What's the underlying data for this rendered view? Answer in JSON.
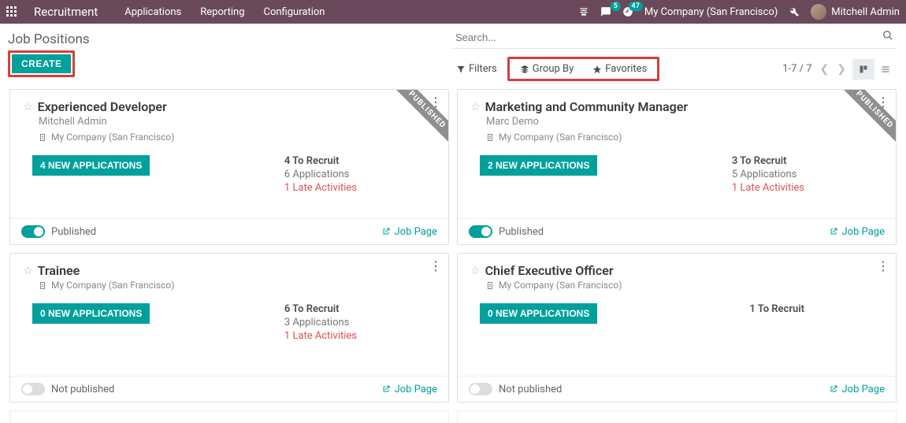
{
  "navbar": {
    "brand": "Recruitment",
    "menu": [
      "Applications",
      "Reporting",
      "Configuration"
    ],
    "messages_badge": "5",
    "activities_badge": "47",
    "company": "My Company (San Francisco)",
    "user": "Mitchell Admin"
  },
  "header": {
    "title": "Job Positions",
    "create_label": "CREATE",
    "search_placeholder": "Search...",
    "filters_label": "Filters",
    "groupby_label": "Group By",
    "favorites_label": "Favorites",
    "pager": "1-7 / 7"
  },
  "common": {
    "job_page_label": "Job Page",
    "published_label": "Published",
    "not_published_label": "Not published",
    "ribbon_label": "PUBLISHED"
  },
  "cards": [
    {
      "title": "Experienced Developer",
      "owner": "Mitchell Admin",
      "company": "My Company (San Francisco)",
      "app_button": "4 NEW APPLICATIONS",
      "recruit": "4 To Recruit",
      "apps": "6 Applications",
      "late": "1 Late Activities",
      "published": true
    },
    {
      "title": "Marketing and Community Manager",
      "owner": "Marc Demo",
      "company": "My Company (San Francisco)",
      "app_button": "2 NEW APPLICATIONS",
      "recruit": "3 To Recruit",
      "apps": "5 Applications",
      "late": "1 Late Activities",
      "published": true
    },
    {
      "title": "Trainee",
      "owner": "",
      "company": "My Company (San Francisco)",
      "app_button": "0 NEW APPLICATIONS",
      "recruit": "6 To Recruit",
      "apps": "3 Applications",
      "late": "1 Late Activities",
      "published": false
    },
    {
      "title": "Chief Executive Officer",
      "owner": "",
      "company": "My Company (San Francisco)",
      "app_button": "0 NEW APPLICATIONS",
      "recruit": "1 To Recruit",
      "apps": "",
      "late": "",
      "published": false
    }
  ]
}
